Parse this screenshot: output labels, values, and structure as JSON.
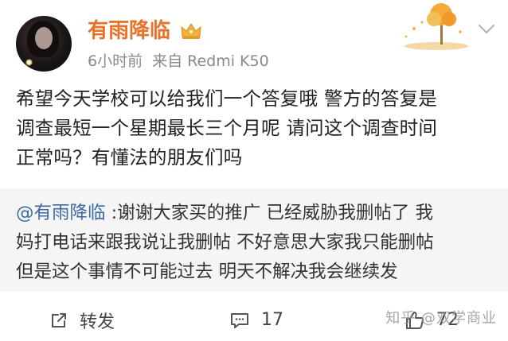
{
  "post": {
    "username": "有雨降临",
    "meta_time": "6小时前",
    "meta_source": "来自 Redmi K50",
    "content_lines": [
      "希望今天学校可以给我们一个答复哦 警方的答复是",
      "调查最短一个星期最长三个月呢 请问这个调查时间",
      "正常吗？有懂法的朋友们吗"
    ]
  },
  "repost": {
    "mention": "@有雨降临",
    "lines_first_rest": " :谢谢大家买的推广 已经威胁我删帖了 我",
    "lines": [
      "妈打电话来跟我说让我删帖 不好意思大家我只能删帖",
      "但是这个事情不可能过去 明天不解决我会继续发"
    ]
  },
  "toolbar": {
    "repost_label": "转发",
    "comment_count": "17",
    "like_count": "72"
  },
  "watermark": "知乎 @双学商业",
  "colors": {
    "username": "#e9722a",
    "mention": "#3d6aa3",
    "repost_bg": "#f5f5f5"
  },
  "icons": [
    "crown-icon",
    "chevron-down-icon",
    "repost-icon",
    "comment-icon",
    "like-icon",
    "autumn-tree-decoration"
  ]
}
